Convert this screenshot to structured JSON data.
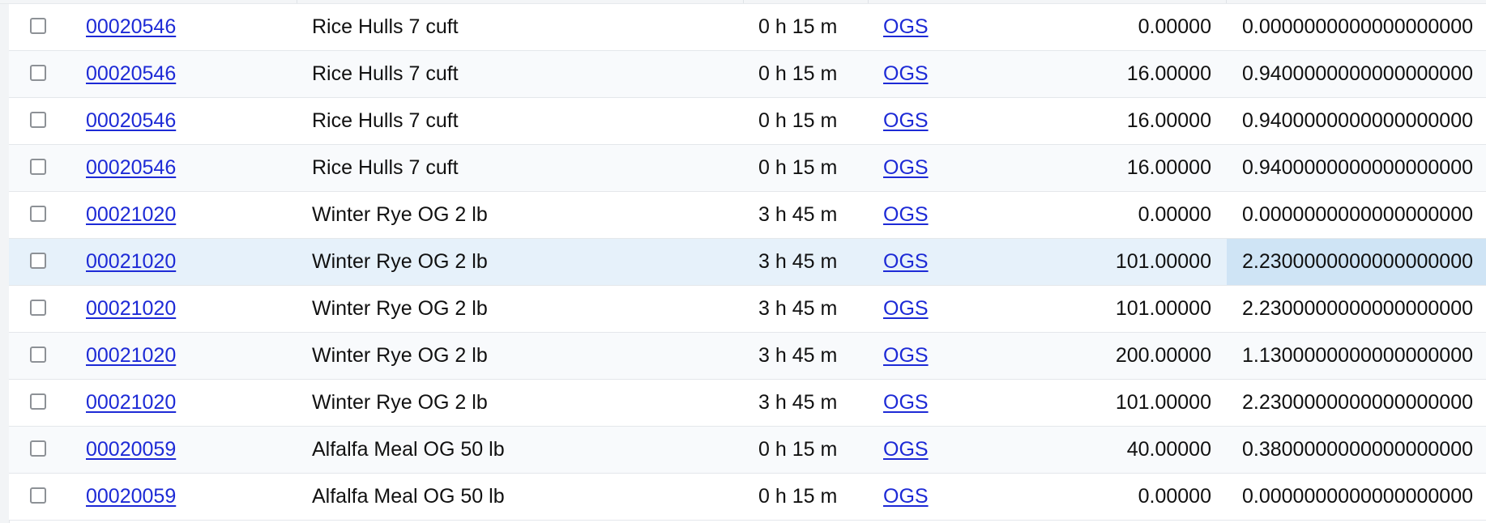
{
  "grid": {
    "rows": [
      {
        "item_id": "00020546",
        "description": "Rice Hulls 7 cuft",
        "time": "0 h 15 m",
        "vendor": "OGS",
        "quantity": "0.00000",
        "cost": "0.0000000000000000000"
      },
      {
        "item_id": "00020546",
        "description": "Rice Hulls 7 cuft",
        "time": "0 h 15 m",
        "vendor": "OGS",
        "quantity": "16.00000",
        "cost": "0.9400000000000000000"
      },
      {
        "item_id": "00020546",
        "description": "Rice Hulls 7 cuft",
        "time": "0 h 15 m",
        "vendor": "OGS",
        "quantity": "16.00000",
        "cost": "0.9400000000000000000"
      },
      {
        "item_id": "00020546",
        "description": "Rice Hulls 7 cuft",
        "time": "0 h 15 m",
        "vendor": "OGS",
        "quantity": "16.00000",
        "cost": "0.9400000000000000000"
      },
      {
        "item_id": "00021020",
        "description": "Winter Rye OG 2 lb",
        "time": "3 h 45 m",
        "vendor": "OGS",
        "quantity": "0.00000",
        "cost": "0.0000000000000000000"
      },
      {
        "item_id": "00021020",
        "description": "Winter Rye OG 2 lb",
        "time": "3 h 45 m",
        "vendor": "OGS",
        "quantity": "101.00000",
        "cost": "2.2300000000000000000"
      },
      {
        "item_id": "00021020",
        "description": "Winter Rye OG 2 lb",
        "time": "3 h 45 m",
        "vendor": "OGS",
        "quantity": "101.00000",
        "cost": "2.2300000000000000000"
      },
      {
        "item_id": "00021020",
        "description": "Winter Rye OG 2 lb",
        "time": "3 h 45 m",
        "vendor": "OGS",
        "quantity": "200.00000",
        "cost": "1.1300000000000000000"
      },
      {
        "item_id": "00021020",
        "description": "Winter Rye OG 2 lb",
        "time": "3 h 45 m",
        "vendor": "OGS",
        "quantity": "101.00000",
        "cost": "2.2300000000000000000"
      },
      {
        "item_id": "00020059",
        "description": "Alfalfa Meal OG 50 lb",
        "time": "0 h 15 m",
        "vendor": "OGS",
        "quantity": "40.00000",
        "cost": "0.3800000000000000000"
      },
      {
        "item_id": "00020059",
        "description": "Alfalfa Meal OG 50 lb",
        "time": "0 h 15 m",
        "vendor": "OGS",
        "quantity": "0.00000",
        "cost": "0.0000000000000000000"
      }
    ]
  },
  "colors": {
    "link": "#1d2ad6",
    "hover_row": "#e6f1fa",
    "selected_cell": "#cfe4f5"
  }
}
